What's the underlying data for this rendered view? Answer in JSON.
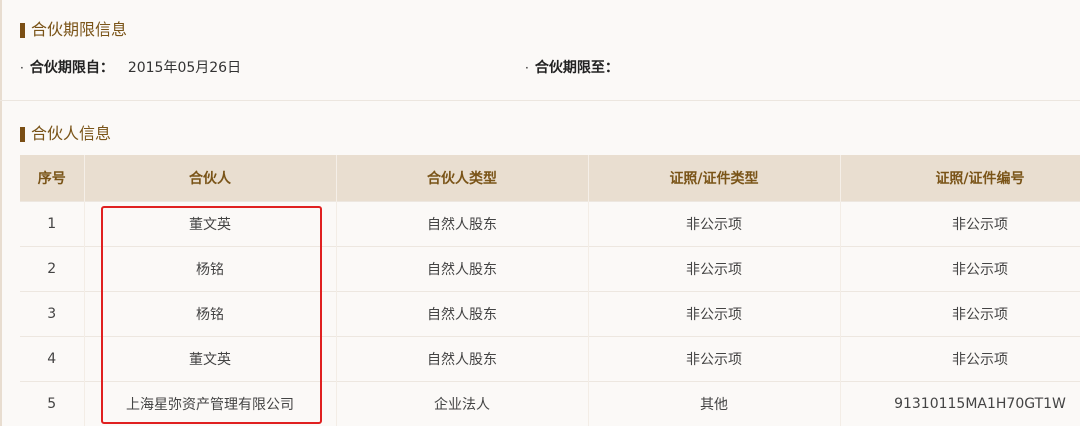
{
  "period_section": {
    "title": "合伙期限信息",
    "start_label": "合伙期限自：",
    "start_value": "2015年05月26日",
    "end_label": "合伙期限至：",
    "end_value": ""
  },
  "partner_section": {
    "title": "合伙人信息",
    "columns": [
      "序号",
      "合伙人",
      "合伙人类型",
      "证照/证件类型",
      "证照/证件编号"
    ],
    "rows": [
      [
        "1",
        "董文英",
        "自然人股东",
        "非公示项",
        "非公示项"
      ],
      [
        "2",
        "杨铭",
        "自然人股东",
        "非公示项",
        "非公示项"
      ],
      [
        "3",
        "杨铭",
        "自然人股东",
        "非公示项",
        "非公示项"
      ],
      [
        "4",
        "董文英",
        "自然人股东",
        "非公示项",
        "非公示项"
      ],
      [
        "5",
        "上海星弥资产管理有限公司",
        "企业法人",
        "其他",
        "91310115MA1H70GT1W"
      ]
    ]
  },
  "colors": {
    "accent": "#7a4e14",
    "header_bg": "#e9ded0",
    "highlight": "#e02020"
  }
}
